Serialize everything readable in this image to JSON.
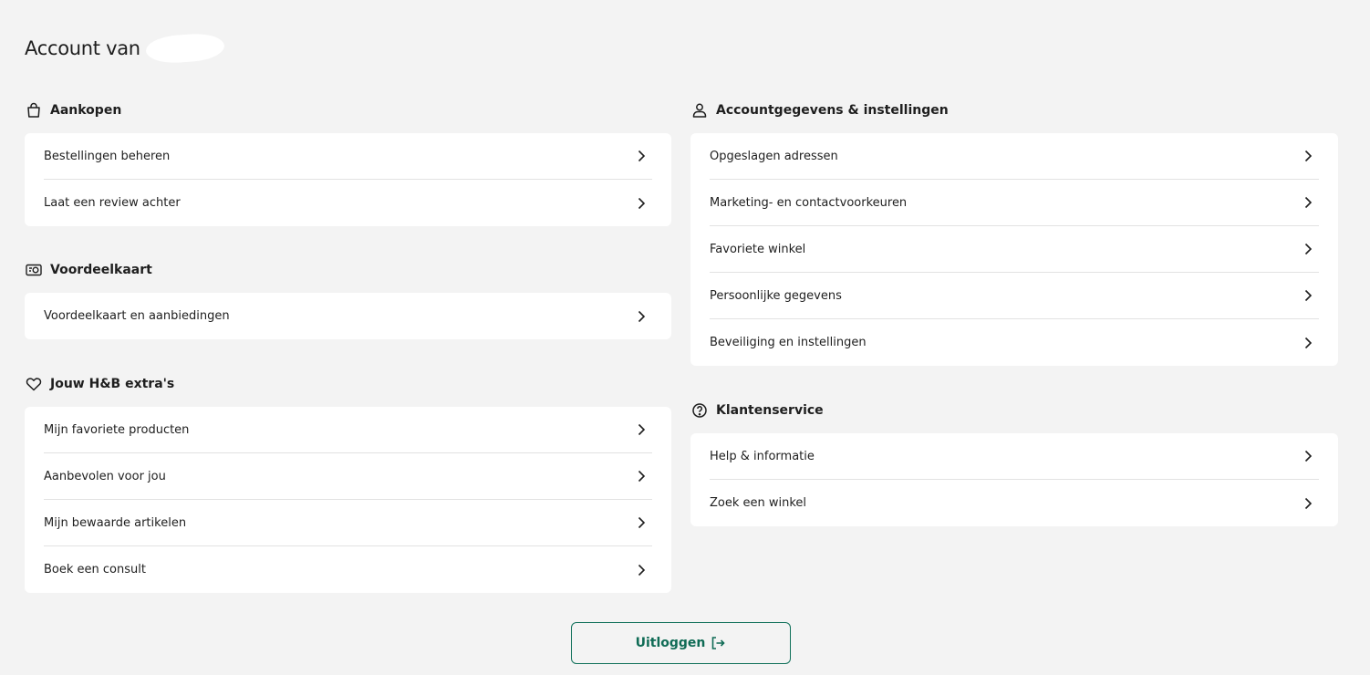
{
  "header": {
    "title": "Account van"
  },
  "left": {
    "aankopen": {
      "title": "Aankopen",
      "icon": "shopping-bag-icon",
      "items": [
        "Bestellingen beheren",
        "Laat een review achter"
      ]
    },
    "voordeelkaart": {
      "title": "Voordeelkaart",
      "icon": "loyalty-card-icon",
      "items": [
        "Voordeelkaart en aanbiedingen"
      ]
    },
    "extras": {
      "title": "Jouw H&B extra's",
      "icon": "heart-icon",
      "items": [
        "Mijn favoriete producten",
        "Aanbevolen voor jou",
        "Mijn bewaarde artikelen",
        "Boek een consult"
      ]
    }
  },
  "right": {
    "account": {
      "title": "Accountgegevens & instellingen",
      "icon": "user-icon",
      "items": [
        "Opgeslagen adressen",
        "Marketing- en contactvoorkeuren",
        "Favoriete winkel",
        "Persoonlijke gegevens",
        "Beveiliging en instellingen"
      ]
    },
    "service": {
      "title": "Klantenservice",
      "icon": "help-circle-icon",
      "items": [
        "Help & informatie",
        "Zoek een winkel"
      ]
    }
  },
  "logout": {
    "label": "Uitloggen",
    "icon": "logout-icon"
  },
  "colors": {
    "background": "#f3f3f3",
    "card": "#ffffff",
    "accent": "#0f6b55",
    "text": "#1e1e1e"
  }
}
